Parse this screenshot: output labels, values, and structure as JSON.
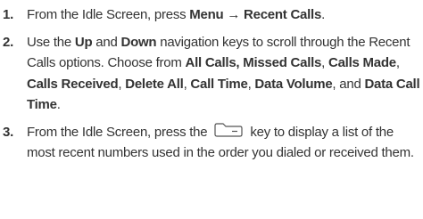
{
  "steps": [
    {
      "number": "1.",
      "t1": "From the Idle Screen, press ",
      "b1": "Menu",
      "t2": " ",
      "arrow": "→",
      "t3": " ",
      "b2": "Recent Calls",
      "t4": "."
    },
    {
      "number": "2.",
      "t1": "Use the ",
      "b1": "Up",
      "t2": " and ",
      "b2": "Down",
      "t3": " navigation keys to scroll through the Recent Calls options. Choose from ",
      "b3": "All Calls, Missed Calls",
      "t4": ", ",
      "b4": "Calls Made",
      "t5": ", ",
      "b5": "Calls Received",
      "t6": ", ",
      "b6": "Delete All",
      "t7": ", ",
      "b7": "Call Time",
      "t8": ", ",
      "b8": "Data Volume",
      "t9": ", and ",
      "b9": "Data Call Time",
      "t10": "."
    },
    {
      "number": "3.",
      "t1": "From the Idle Screen, press the",
      "icon": "send-key-icon",
      "t2": "key to display a list of the most recent numbers used in the order you dialed or received them."
    }
  ],
  "colors": {
    "text": "#333333",
    "icon_stroke": "#555555"
  }
}
